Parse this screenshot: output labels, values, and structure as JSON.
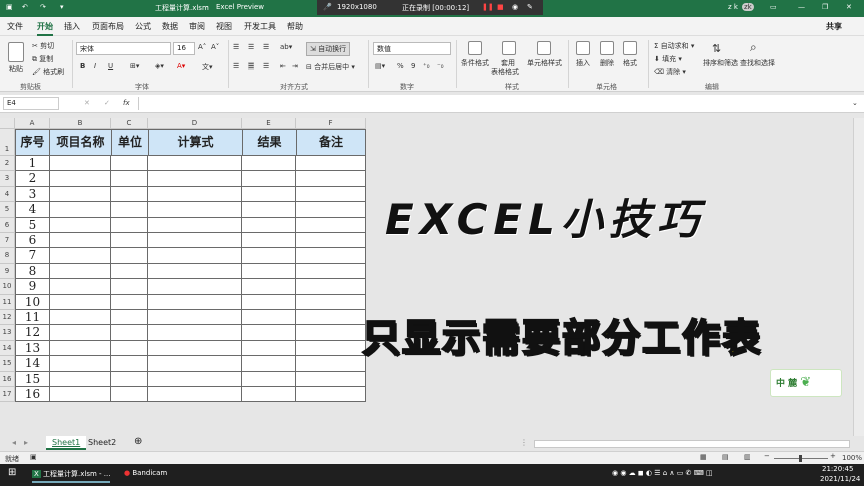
{
  "titlebar": {
    "filename": "工程量计算.xlsm",
    "separator": "-",
    "app": "Excel Preview",
    "resolution": "1920x1080",
    "recording": "正在录制 [00:00:12]",
    "user": "z k",
    "avatar": "zk"
  },
  "menu": [
    "文件",
    "开始",
    "插入",
    "页面布局",
    "公式",
    "数据",
    "审阅",
    "视图",
    "开发工具",
    "帮助"
  ],
  "share": "共享",
  "ribbon": {
    "clipboard": {
      "paste": "粘贴",
      "cut": "剪切",
      "copy": "复制",
      "format_painter": "格式刷",
      "label": "剪贴板"
    },
    "font": {
      "name": "宋体",
      "size": "16",
      "bold": "B",
      "italic": "I",
      "underline": "U",
      "label": "字体"
    },
    "alignment": {
      "wrap": "自动换行",
      "merge": "合并后居中",
      "label": "对齐方式"
    },
    "number": {
      "format": "数值",
      "percent": "%",
      "comma": "9",
      "label": "数字"
    },
    "styles": {
      "conditional": "条件格式",
      "table_line1": "套用",
      "table_line2": "表格格式",
      "cell_styles": "单元格样式",
      "label": "样式"
    },
    "cells": {
      "insert": "插入",
      "delete": "删除",
      "format": "格式",
      "label": "单元格"
    },
    "editing": {
      "autosum": "自动求和",
      "fill": "填充",
      "clear": "清除",
      "sort": "排序和筛选",
      "find": "查找和选择",
      "label": "编辑"
    }
  },
  "formula_bar": {
    "name_box": "E4",
    "fx": "fx",
    "value": ""
  },
  "sheet": {
    "columns": [
      "A",
      "B",
      "C",
      "D",
      "E",
      "F"
    ],
    "headers": [
      "序号",
      "项目名称",
      "单位",
      "计算式",
      "结果",
      "备注"
    ],
    "rows": [
      "1",
      "2",
      "3",
      "4",
      "5",
      "6",
      "7",
      "8",
      "9",
      "10",
      "11",
      "12",
      "13",
      "14",
      "15",
      "16"
    ],
    "row_numbers": [
      "1",
      "2",
      "3",
      "4",
      "5",
      "6",
      "7",
      "8",
      "9",
      "10",
      "11",
      "12",
      "13",
      "14",
      "15",
      "16",
      "17"
    ]
  },
  "overlay": {
    "title": "EXCEL小技巧",
    "subtitle": "只显示需要部分工作表",
    "logo": "中 麓"
  },
  "tabs": [
    "Sheet1",
    "Sheet2"
  ],
  "statusbar": {
    "ready": "就绪",
    "zoom": "100%"
  },
  "taskbar": {
    "excel": "工程量计算.xlsm - ...",
    "bandicam": "Bandicam",
    "time": "21:20:45",
    "date": "2021/11/24"
  },
  "colors": {
    "accent": "#217346",
    "header_fill": "#cfe5f7",
    "overlay_yellow": "#f6e200"
  }
}
